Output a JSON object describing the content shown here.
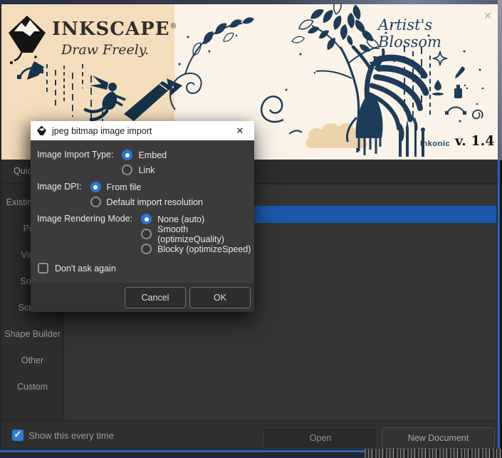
{
  "banner": {
    "brand": "INKSCAPE",
    "registered": "®",
    "tagline": "Draw Freely.",
    "artwork_title": "Artist's Blossom",
    "artwork_credit": "Inkonic",
    "version": "v. 1.4"
  },
  "import_dialog": {
    "title": "jpeg bitmap image import",
    "close": "✕",
    "groups": [
      {
        "label": "Image Import Type:",
        "options": [
          {
            "label": "Embed",
            "selected": true
          },
          {
            "label": "Link",
            "selected": false
          }
        ]
      },
      {
        "label": "Image DPI:",
        "options": [
          {
            "label": "From file",
            "selected": true
          },
          {
            "label": "Default import resolution",
            "selected": false
          }
        ]
      },
      {
        "label": "Image Rendering Mode:",
        "options": [
          {
            "label": "None (auto)",
            "selected": true
          },
          {
            "label": "Smooth (optimizeQuality)",
            "selected": false
          },
          {
            "label": "Blocky (optimizeSpeed)",
            "selected": false
          }
        ]
      }
    ],
    "dont_ask": {
      "label": "Don't ask again",
      "checked": false
    },
    "cancel_label": "Cancel",
    "ok_label": "OK"
  },
  "welcome": {
    "tab_label": "Quick Setup",
    "sidebar": [
      {
        "label": "Existing Files"
      },
      {
        "label": "Print"
      },
      {
        "label": "Video"
      },
      {
        "label": "Social"
      },
      {
        "label": "Screen"
      },
      {
        "label": "Shape Builder"
      },
      {
        "label": "Other"
      },
      {
        "label": "Custom"
      }
    ],
    "show_every_time": {
      "label": "Show this every time",
      "checked": true
    },
    "open_label": "Open",
    "new_document_label": "New Document"
  },
  "colors": {
    "selection_blue": "#1b57ab",
    "radio_blue": "#2676d9",
    "banner_tan": "#f3ddba",
    "banner_cream": "#fbf3e8",
    "art_navy": "#1d3c59"
  }
}
